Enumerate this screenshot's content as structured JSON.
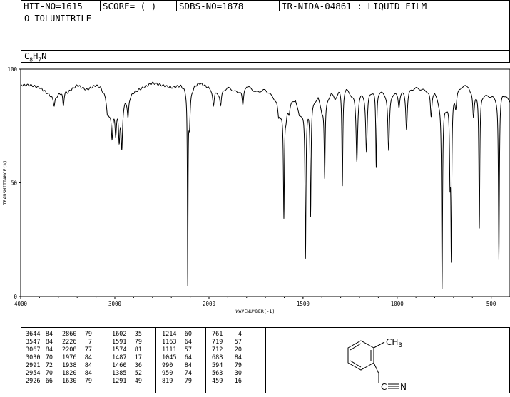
{
  "header": {
    "hit_no": "HIT-NO=1615",
    "score": "SCORE=  (   )",
    "sdbs_no": "SDBS-NO=1878",
    "ir_info": "IR-NIDA-04861 : LIQUID FILM"
  },
  "compound": {
    "name": "O-TOLUNITRILE",
    "formula_parts": [
      "C",
      "8",
      "H",
      "7",
      "N"
    ]
  },
  "chart_data": {
    "type": "line",
    "xlabel": "WAVENUMBER(-1)",
    "ylabel": "TRANSMITTANCE(%)",
    "xlim": [
      4000,
      400
    ],
    "ylim": [
      0,
      100
    ],
    "x_ticks": [
      4000,
      3000,
      2000,
      1500,
      1000,
      500
    ],
    "y_ticks": [
      100,
      50,
      0
    ],
    "x_tick_labels": [
      "4000",
      "3000",
      "2000",
      "1500",
      "1000",
      "500"
    ],
    "y_tick_labels": [
      "100",
      "50",
      "0"
    ],
    "line_color": "#000000",
    "baseline": [
      [
        4000,
        93
      ],
      [
        3900,
        93
      ],
      [
        3800,
        92
      ],
      [
        3700,
        89
      ],
      [
        3644,
        87
      ],
      [
        3600,
        89
      ],
      [
        3547,
        91
      ],
      [
        3500,
        90
      ],
      [
        3400,
        93
      ],
      [
        3300,
        91
      ],
      [
        3200,
        93
      ],
      [
        3150,
        92
      ],
      [
        3100,
        88
      ],
      [
        3090,
        85
      ],
      [
        3080,
        80
      ],
      [
        2800,
        90
      ],
      [
        2700,
        92
      ],
      [
        2600,
        94
      ],
      [
        2400,
        92
      ],
      [
        2300,
        93
      ],
      [
        2260,
        92
      ],
      [
        2200,
        90
      ],
      [
        2150,
        93
      ],
      [
        2100,
        94
      ],
      [
        2000,
        92
      ],
      [
        1950,
        90
      ],
      [
        1900,
        92
      ],
      [
        1850,
        90
      ],
      [
        1800,
        93
      ],
      [
        1750,
        90
      ],
      [
        1700,
        91
      ],
      [
        1660,
        88
      ],
      [
        1640,
        86
      ],
      [
        1620,
        81
      ],
      [
        1560,
        86
      ],
      [
        1540,
        87
      ],
      [
        1520,
        80
      ],
      [
        1420,
        88
      ],
      [
        1400,
        82
      ],
      [
        1350,
        90
      ],
      [
        1330,
        87
      ],
      [
        1310,
        91
      ],
      [
        1270,
        92
      ],
      [
        1240,
        89
      ],
      [
        1200,
        90
      ],
      [
        1150,
        91
      ],
      [
        1100,
        91
      ],
      [
        1060,
        90
      ],
      [
        1000,
        90
      ],
      [
        960,
        91
      ],
      [
        900,
        92
      ],
      [
        850,
        91
      ],
      [
        800,
        91
      ],
      [
        780,
        86
      ],
      [
        740,
        84
      ],
      [
        720,
        88
      ],
      [
        700,
        90
      ],
      [
        650,
        93
      ],
      [
        620,
        93
      ],
      [
        610,
        91
      ],
      [
        560,
        90
      ],
      [
        540,
        89
      ],
      [
        470,
        88
      ],
      [
        440,
        90
      ],
      [
        400,
        86
      ]
    ],
    "peaks": [
      [
        3644,
        84
      ],
      [
        3547,
        84
      ],
      [
        3067,
        84
      ],
      [
        3030,
        70
      ],
      [
        2991,
        72
      ],
      [
        2954,
        70
      ],
      [
        2926,
        66
      ],
      [
        2860,
        79
      ],
      [
        2226,
        7
      ],
      [
        2208,
        77
      ],
      [
        1976,
        84
      ],
      [
        1938,
        84
      ],
      [
        1820,
        84
      ],
      [
        1630,
        79
      ],
      [
        1602,
        35
      ],
      [
        1591,
        79
      ],
      [
        1574,
        81
      ],
      [
        1487,
        17
      ],
      [
        1460,
        36
      ],
      [
        1385,
        52
      ],
      [
        1291,
        49
      ],
      [
        1214,
        60
      ],
      [
        1163,
        64
      ],
      [
        1111,
        57
      ],
      [
        1045,
        64
      ],
      [
        990,
        84
      ],
      [
        950,
        74
      ],
      [
        819,
        79
      ],
      [
        761,
        4
      ],
      [
        719,
        57
      ],
      [
        712,
        20
      ],
      [
        688,
        84
      ],
      [
        594,
        79
      ],
      [
        563,
        30
      ],
      [
        459,
        16
      ]
    ],
    "peak_table": [
      [
        [
          "3644",
          "84"
        ],
        [
          "3547",
          "84"
        ],
        [
          "3067",
          "84"
        ],
        [
          "3030",
          "70"
        ],
        [
          "2991",
          "72"
        ],
        [
          "2954",
          "70"
        ],
        [
          "2926",
          "66"
        ]
      ],
      [
        [
          "2860",
          "79"
        ],
        [
          "2226",
          "7"
        ],
        [
          "2208",
          "77"
        ],
        [
          "1976",
          "84"
        ],
        [
          "1938",
          "84"
        ],
        [
          "1820",
          "84"
        ],
        [
          "1630",
          "79"
        ]
      ],
      [
        [
          "1602",
          "35"
        ],
        [
          "1591",
          "79"
        ],
        [
          "1574",
          "81"
        ],
        [
          "1487",
          "17"
        ],
        [
          "1460",
          "36"
        ],
        [
          "1385",
          "52"
        ],
        [
          "1291",
          "49"
        ]
      ],
      [
        [
          "1214",
          "60"
        ],
        [
          "1163",
          "64"
        ],
        [
          "1111",
          "57"
        ],
        [
          "1045",
          "64"
        ],
        [
          "990",
          "84"
        ],
        [
          "950",
          "74"
        ],
        [
          "819",
          "79"
        ]
      ],
      [
        [
          "761",
          "4"
        ],
        [
          "719",
          "57"
        ],
        [
          "712",
          "20"
        ],
        [
          "688",
          "84"
        ],
        [
          "594",
          "79"
        ],
        [
          "563",
          "30"
        ],
        [
          "459",
          "16"
        ]
      ]
    ]
  },
  "structure": {
    "substituent_top": "CH",
    "substituent_top_sub": "3",
    "substituent_bottom_bond": "C",
    "substituent_bottom_atom": "N"
  }
}
